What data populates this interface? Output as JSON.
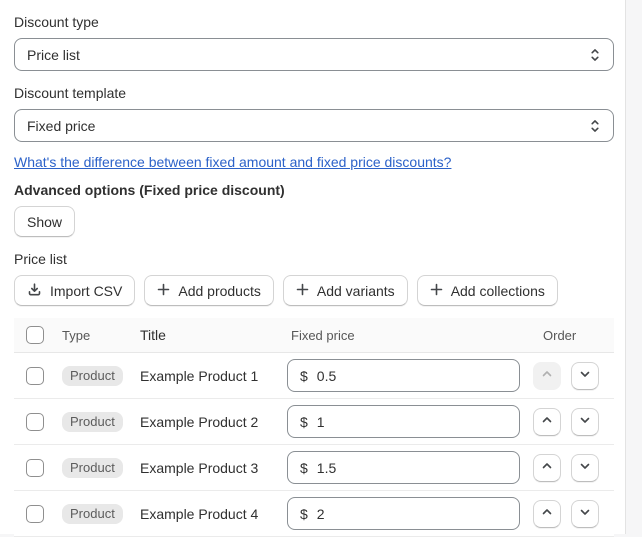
{
  "form": {
    "discount_type": {
      "label": "Discount type",
      "value": "Price list"
    },
    "discount_template": {
      "label": "Discount template",
      "value": "Fixed price"
    },
    "help_link_text": "What's the difference between fixed amount and fixed price discounts?",
    "advanced_heading": "Advanced options (Fixed price discount)",
    "show_button_label": "Show",
    "price_list_label": "Price list"
  },
  "toolbar": {
    "import_csv_label": "Import CSV",
    "add_products_label": "Add products",
    "add_variants_label": "Add variants",
    "add_collections_label": "Add collections"
  },
  "table": {
    "headers": {
      "type": "Type",
      "title": "Title",
      "fixed_price": "Fixed price",
      "order": "Order"
    },
    "currency_prefix": "$",
    "rows": [
      {
        "type": "Product",
        "title": "Example Product 1",
        "price": "0.5",
        "up_disabled": true
      },
      {
        "type": "Product",
        "title": "Example Product 2",
        "price": "1",
        "up_disabled": false
      },
      {
        "type": "Product",
        "title": "Example Product 3",
        "price": "1.5",
        "up_disabled": false
      },
      {
        "type": "Product",
        "title": "Example Product 4",
        "price": "2",
        "up_disabled": false
      }
    ]
  },
  "icons": {
    "select_caret": "updown-caret-icon",
    "import": "download-icon",
    "add": "plus-icon",
    "move_up": "chevron-up-icon",
    "move_down": "chevron-down-icon"
  },
  "colors": {
    "link_blue": "#2c62c9",
    "text": "#303030",
    "field_border": "#8a8f94",
    "table_header_bg": "#fafafa",
    "badge_bg": "#e8e8e8",
    "disabled_button_bg": "#f1f1f1"
  }
}
